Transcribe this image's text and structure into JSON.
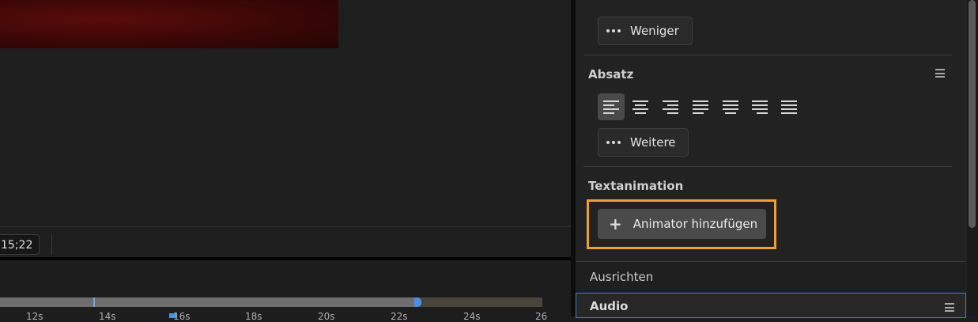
{
  "transport": {
    "timecode": "15;22"
  },
  "timeline": {
    "ruler_labels": [
      "12s",
      "14s",
      "16s",
      "18s",
      "20s",
      "22s",
      "24s",
      "26"
    ]
  },
  "properties": {
    "less_button_label": "Weniger",
    "paragraph": {
      "title": "Absatz",
      "alignment_options": [
        "align-left",
        "align-center",
        "align-right",
        "justify-last-left",
        "justify-last-center",
        "justify-last-right",
        "justify-all"
      ],
      "selected_alignment": "align-left",
      "more_button_label": "Weitere"
    },
    "text_animation": {
      "title": "Textanimation",
      "add_animator_label": "Animator hinzufügen",
      "add_icon": "plus-icon",
      "highlight_color": "#f0a030"
    },
    "sections": {
      "align_label": "Ausrichten",
      "audio_label": "Audio"
    }
  },
  "colors": {
    "accent_blue": "#4c8ee6",
    "highlight_orange": "#f0a030",
    "panel_bg": "#222222"
  }
}
